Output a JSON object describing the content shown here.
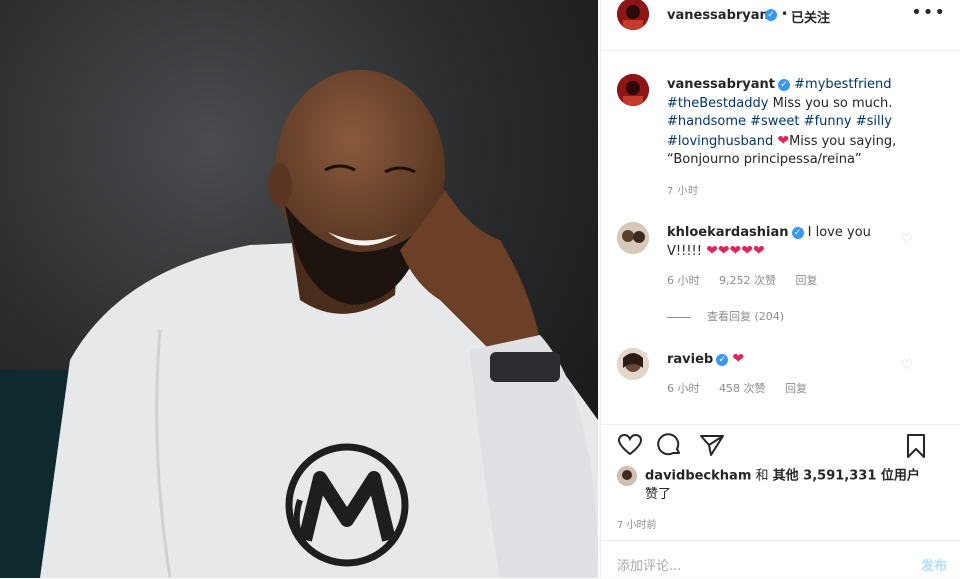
{
  "header": {
    "username": "vanessabryant",
    "verified": "✓",
    "dot": "•",
    "follow_label": "已关注",
    "more": "•••"
  },
  "caption": {
    "username": "vanessabryant",
    "verified": "✓",
    "parts": {
      "t1": "#mybestfriend",
      "t2": "#theBestdaddy",
      "s1": " Miss you so much. ",
      "t3": "#handsome",
      "t4": "#sweet",
      "t5": "#funny",
      "t6": "#silly",
      "t7": "#lovinghusband",
      "heart": "❤",
      "s2": "Miss you saying, “Bonjourno principessa/reina”"
    },
    "time": "7 小时"
  },
  "comments": [
    {
      "username": "khloekardashian",
      "verified": "✓",
      "text": "I love you V!!!!! ",
      "hearts": "❤❤❤❤❤",
      "time": "6 小时",
      "likes": "9,252 次赞",
      "reply": "回复",
      "view_replies": "查看回复 (204)"
    },
    {
      "username": "ravieb",
      "verified": "✓",
      "hearts": "❤",
      "time": "6 小时",
      "likes": "458 次赞",
      "reply": "回复"
    }
  ],
  "likes_line": {
    "user": "davidbeckham",
    "and": " 和 ",
    "others": "其他 3,591,331 位用户",
    "suffix": "赞了"
  },
  "post_time": "7 小时前",
  "add_comment": {
    "placeholder": "添加评论...",
    "post_label": "发布"
  },
  "colors": {
    "accent": "#3897f0",
    "hashtag": "#00376b",
    "heart": "#e0245e",
    "muted": "#8e8e8e"
  },
  "icons": [
    "heart-icon",
    "comment-icon",
    "share-icon",
    "bookmark-icon",
    "more-icon",
    "verified-icon"
  ]
}
